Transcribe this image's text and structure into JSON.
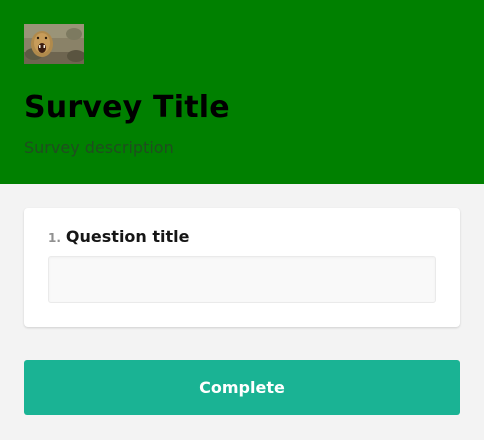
{
  "survey": {
    "logo_icon": "lion-photo-logo",
    "title": "Survey Title",
    "description": "Survey description",
    "header_color": "#008000"
  },
  "question": {
    "number": "1.",
    "title": "Question title",
    "input_value": "",
    "input_placeholder": ""
  },
  "actions": {
    "complete_label": "Complete",
    "complete_color": "#1ab394"
  }
}
